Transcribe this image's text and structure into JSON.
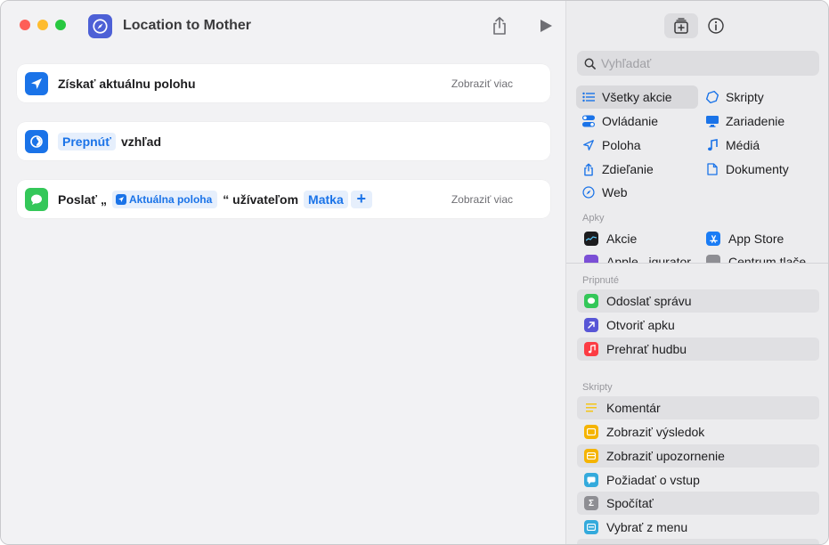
{
  "window": {
    "title": "Location to Mother"
  },
  "workflow": {
    "step1": {
      "label": "Získať aktuálnu polohu",
      "more": "Zobraziť viac"
    },
    "step2": {
      "token": "Prepnúť",
      "label": "vzhľad"
    },
    "step3": {
      "prefix": "Poslať „",
      "variable": "Aktuálna poloha",
      "middle": "“ užívateľom",
      "contact": "Matka",
      "add": "+",
      "more": "Zobraziť viac"
    }
  },
  "library": {
    "search_placeholder": "Vyhľadať",
    "categories_left": [
      "Všetky akcie",
      "Ovládanie",
      "Poloha",
      "Zdieľanie",
      "Web"
    ],
    "categories_right": [
      "Skripty",
      "Zariadenie",
      "Médiá",
      "Dokumenty"
    ],
    "apps_label": "Apky",
    "apps": [
      "Akcie",
      "App Store",
      "Apple...igurator",
      "Centrum tlače"
    ],
    "pinned_label": "Pripnuté",
    "pinned": [
      "Odoslať správu",
      "Otvoriť apku",
      "Prehrať hudbu"
    ],
    "scripts_label": "Skripty",
    "scripts": [
      "Komentár",
      "Zobraziť výsledok",
      "Zobraziť upozornenie",
      "Požiadať o vstup",
      "Spočítať",
      "Vybrať z menu"
    ]
  },
  "colors": {
    "accent": "#1a73e8",
    "app_icon": "#4d60d6",
    "messages_green": "#34c759",
    "traffic_close": "#fe5f57",
    "traffic_min": "#febc2e",
    "traffic_max": "#28c840"
  }
}
